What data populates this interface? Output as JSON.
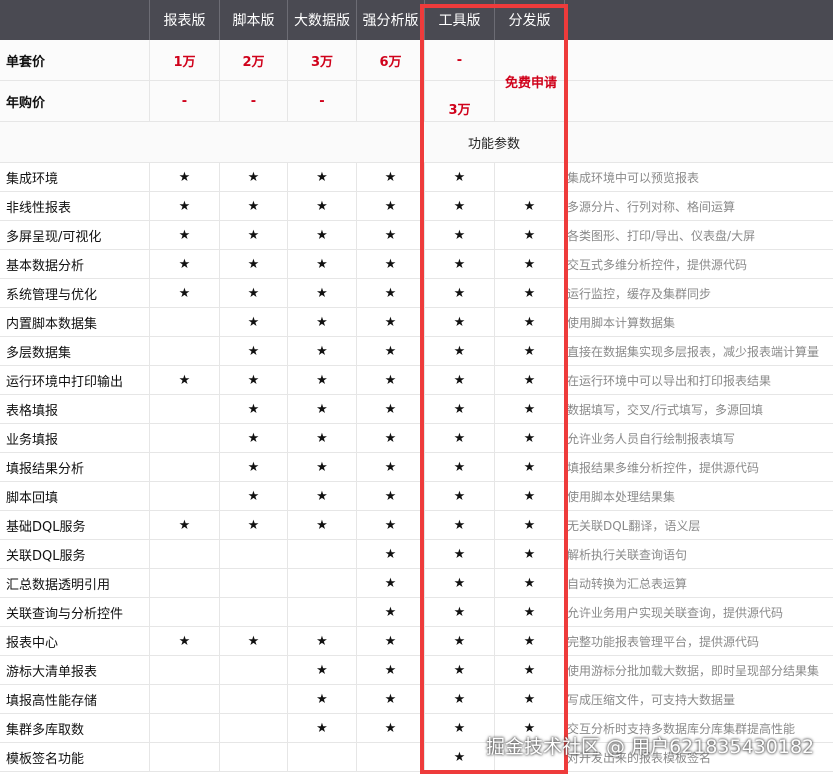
{
  "header": {
    "columns": [
      "报表版",
      "脚本版",
      "大数据版",
      "强分析版",
      "工具版",
      "分发版"
    ]
  },
  "pricing": [
    {
      "label": "单套价",
      "values": [
        "1万",
        "2万",
        "3万",
        "6万",
        "-",
        ""
      ]
    },
    {
      "label": "年购价",
      "values": [
        "-",
        "-",
        "-",
        "",
        "3万",
        ""
      ]
    }
  ],
  "free_label": "免费申请",
  "section_label": "功能参数",
  "star_glyph": "★",
  "features": [
    {
      "name": "集成环境",
      "marks": [
        1,
        1,
        1,
        1,
        1,
        0
      ],
      "desc": "集成环境中可以预览报表"
    },
    {
      "name": "非线性报表",
      "marks": [
        1,
        1,
        1,
        1,
        1,
        1
      ],
      "desc": "多源分片、行列对称、格间运算"
    },
    {
      "name": "多屏呈现/可视化",
      "marks": [
        1,
        1,
        1,
        1,
        1,
        1
      ],
      "desc": "各类图形、打印/导出、仪表盘/大屏"
    },
    {
      "name": "基本数据分析",
      "marks": [
        1,
        1,
        1,
        1,
        1,
        1
      ],
      "desc": "交互式多维分析控件，提供源代码"
    },
    {
      "name": "系统管理与优化",
      "marks": [
        1,
        1,
        1,
        1,
        1,
        1
      ],
      "desc": "运行监控，缓存及集群同步"
    },
    {
      "name": "内置脚本数据集",
      "marks": [
        0,
        1,
        1,
        1,
        1,
        1
      ],
      "desc": "使用脚本计算数据集"
    },
    {
      "name": "多层数据集",
      "marks": [
        0,
        1,
        1,
        1,
        1,
        1
      ],
      "desc": "直接在数据集实现多层报表，减少报表端计算量"
    },
    {
      "name": "运行环境中打印输出",
      "marks": [
        1,
        1,
        1,
        1,
        1,
        1
      ],
      "desc": "在运行环境中可以导出和打印报表结果"
    },
    {
      "name": "表格填报",
      "marks": [
        0,
        1,
        1,
        1,
        1,
        1
      ],
      "desc": "数据填写，交叉/行式填写，多源回填"
    },
    {
      "name": "业务填报",
      "marks": [
        0,
        1,
        1,
        1,
        1,
        1
      ],
      "desc": "允许业务人员自行绘制报表填写"
    },
    {
      "name": "填报结果分析",
      "marks": [
        0,
        1,
        1,
        1,
        1,
        1
      ],
      "desc": "填报结果多维分析控件，提供源代码"
    },
    {
      "name": "脚本回填",
      "marks": [
        0,
        1,
        1,
        1,
        1,
        1
      ],
      "desc": "使用脚本处理结果集"
    },
    {
      "name": "基础DQL服务",
      "marks": [
        1,
        1,
        1,
        1,
        1,
        1
      ],
      "desc": "无关联DQL翻译，语义层"
    },
    {
      "name": "关联DQL服务",
      "marks": [
        0,
        0,
        0,
        1,
        1,
        1
      ],
      "desc": "解析执行关联查询语句"
    },
    {
      "name": "汇总数据透明引用",
      "marks": [
        0,
        0,
        0,
        1,
        1,
        1
      ],
      "desc": "自动转换为汇总表运算"
    },
    {
      "name": "关联查询与分析控件",
      "marks": [
        0,
        0,
        0,
        1,
        1,
        1
      ],
      "desc": "允许业务用户实现关联查询，提供源代码"
    },
    {
      "name": "报表中心",
      "marks": [
        1,
        1,
        1,
        1,
        1,
        1
      ],
      "desc": "完整功能报表管理平台，提供源代码"
    },
    {
      "name": "游标大清单报表",
      "marks": [
        0,
        0,
        1,
        1,
        1,
        1
      ],
      "desc": "使用游标分批加载大数据，即时呈现部分结果集"
    },
    {
      "name": "填报高性能存储",
      "marks": [
        0,
        0,
        1,
        1,
        1,
        1
      ],
      "desc": "写成压缩文件，可支持大数据量"
    },
    {
      "name": "集群多库取数",
      "marks": [
        0,
        0,
        1,
        1,
        1,
        1
      ],
      "desc": "交互分析时支持多数据库分库集群提高性能"
    },
    {
      "name": "模板签名功能",
      "marks": [
        0,
        0,
        0,
        0,
        1,
        0
      ],
      "desc": "对开发出来的报表模板签名"
    }
  ],
  "watermark": "掘金技术社区 @ 用户6218354301​82"
}
